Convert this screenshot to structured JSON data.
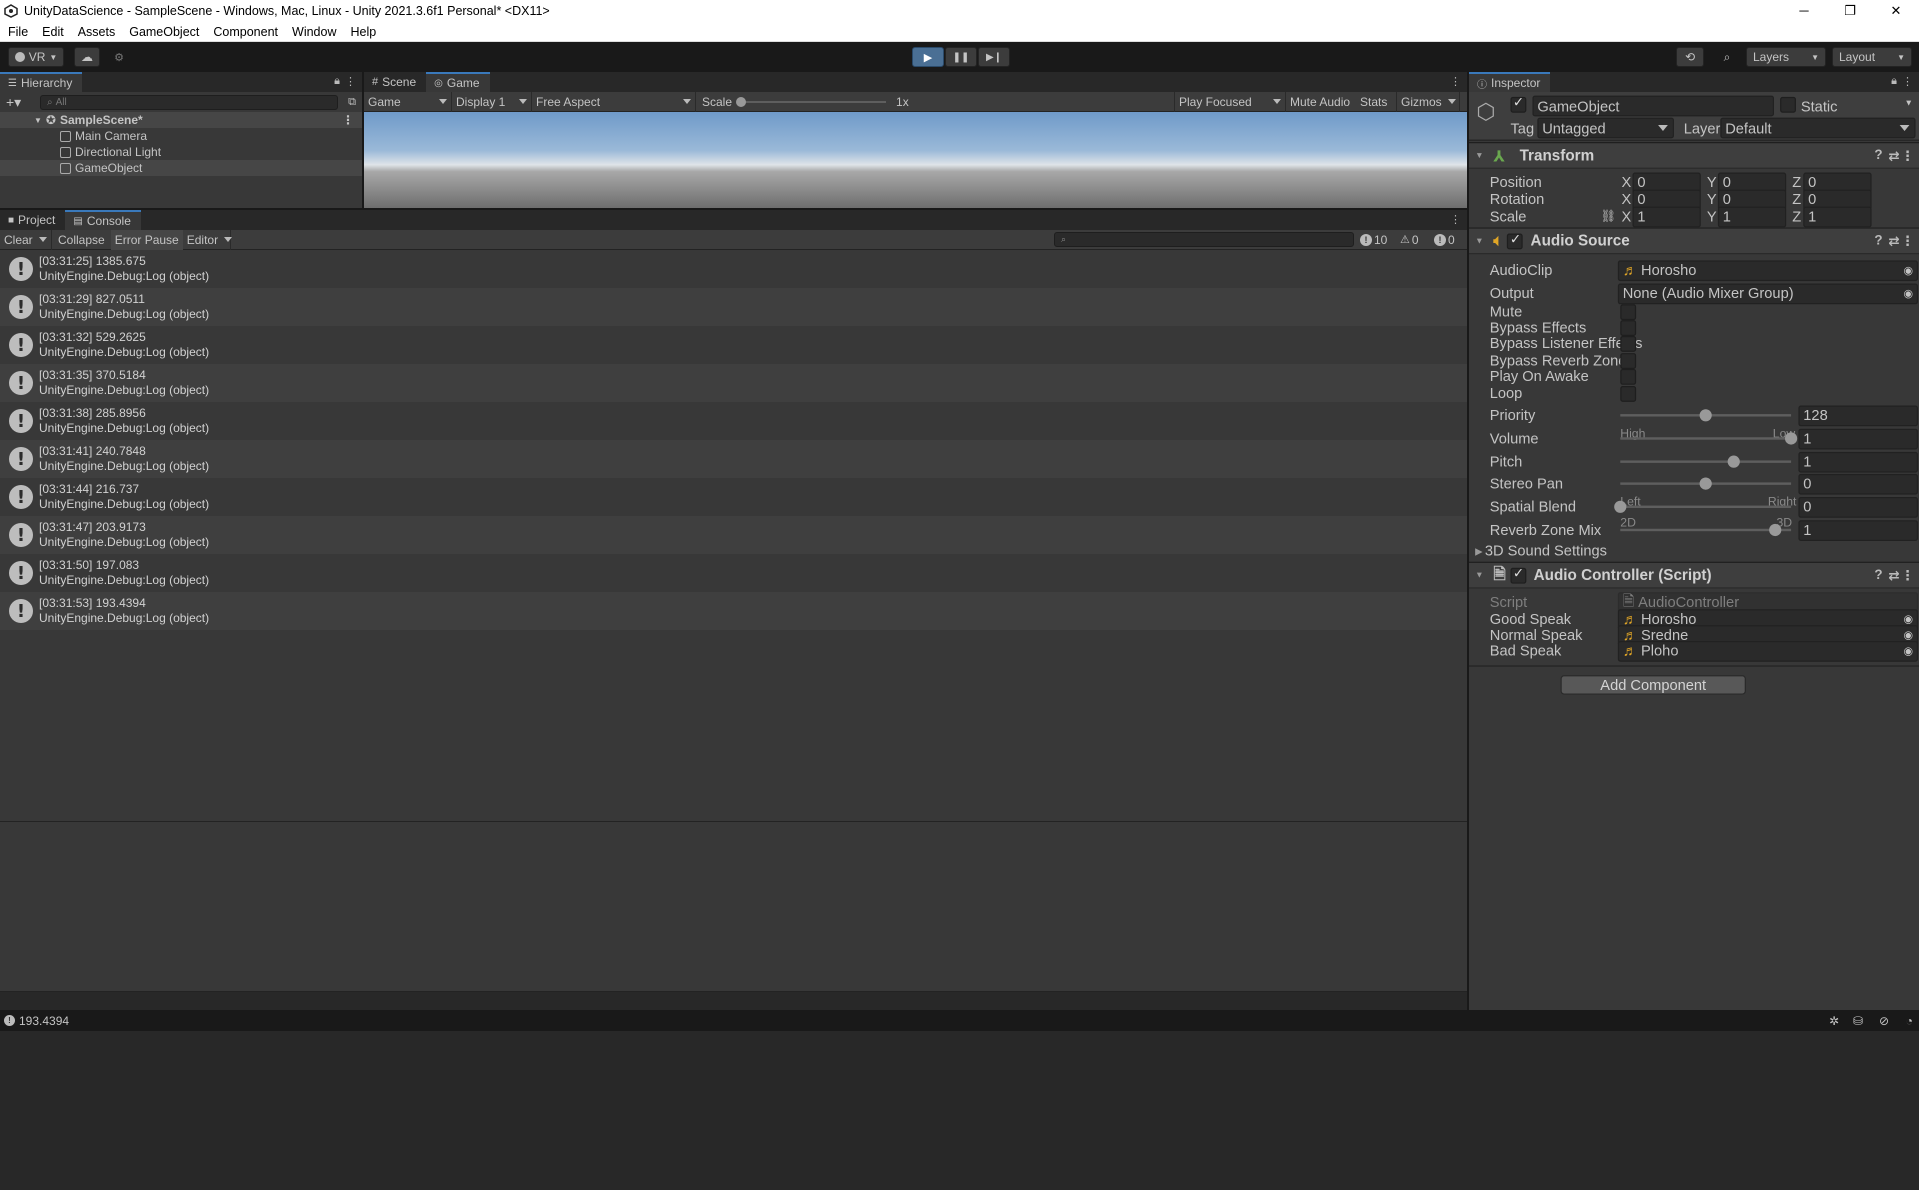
{
  "window": {
    "title": "UnityDataScience - SampleScene - Windows, Mac, Linux - Unity 2021.3.6f1 Personal* <DX11>",
    "minimize": "─",
    "maximize": "❐",
    "close": "✕"
  },
  "menu": [
    "File",
    "Edit",
    "Assets",
    "GameObject",
    "Component",
    "Window",
    "Help"
  ],
  "toolbar": {
    "account": "VR",
    "layers": "Layers",
    "layout": "Layout"
  },
  "hierarchy": {
    "tab": "Hierarchy",
    "search_placeholder": "All",
    "scene": "SampleScene*",
    "items": [
      "Main Camera",
      "Directional Light",
      "GameObject"
    ]
  },
  "game_view": {
    "tabs": [
      "Scene",
      "Game"
    ],
    "mode": "Game",
    "display": "Display 1",
    "aspect": "Free Aspect",
    "scale_label": "Scale",
    "scale_value": "1x",
    "play_focused": "Play Focused",
    "mute_audio": "Mute Audio",
    "stats": "Stats",
    "gizmos": "Gizmos"
  },
  "console": {
    "tabs": [
      "Project",
      "Console"
    ],
    "clear": "Clear",
    "collapse": "Collapse",
    "error_pause": "Error Pause",
    "editor": "Editor",
    "count_log": "10",
    "count_warn": "0",
    "count_error": "0",
    "entries": [
      {
        "line1": "[03:31:25] 1385.675",
        "line2": "UnityEngine.Debug:Log (object)"
      },
      {
        "line1": "[03:31:29] 827.0511",
        "line2": "UnityEngine.Debug:Log (object)"
      },
      {
        "line1": "[03:31:32] 529.2625",
        "line2": "UnityEngine.Debug:Log (object)"
      },
      {
        "line1": "[03:31:35] 370.5184",
        "line2": "UnityEngine.Debug:Log (object)"
      },
      {
        "line1": "[03:31:38] 285.8956",
        "line2": "UnityEngine.Debug:Log (object)"
      },
      {
        "line1": "[03:31:41] 240.7848",
        "line2": "UnityEngine.Debug:Log (object)"
      },
      {
        "line1": "[03:31:44] 216.737",
        "line2": "UnityEngine.Debug:Log (object)"
      },
      {
        "line1": "[03:31:47] 203.9173",
        "line2": "UnityEngine.Debug:Log (object)"
      },
      {
        "line1": "[03:31:50] 197.083",
        "line2": "UnityEngine.Debug:Log (object)"
      },
      {
        "line1": "[03:31:53] 193.4394",
        "line2": "UnityEngine.Debug:Log (object)"
      }
    ]
  },
  "inspector": {
    "tab": "Inspector",
    "object_name": "GameObject",
    "static": "Static",
    "tag_label": "Tag",
    "tag_value": "Untagged",
    "layer_label": "Layer",
    "layer_value": "Default",
    "transform": {
      "title": "Transform",
      "position": {
        "label": "Position",
        "x": "0",
        "y": "0",
        "z": "0"
      },
      "rotation": {
        "label": "Rotation",
        "x": "0",
        "y": "0",
        "z": "0"
      },
      "scale": {
        "label": "Scale",
        "x": "1",
        "y": "1",
        "z": "1"
      }
    },
    "audio_source": {
      "title": "Audio Source",
      "audioclip_label": "AudioClip",
      "audioclip_value": "Horosho",
      "output_label": "Output",
      "output_value": "None (Audio Mixer Group)",
      "toggles": [
        "Mute",
        "Bypass Effects",
        "Bypass Listener Effects",
        "Bypass Reverb Zones",
        "Play On Awake",
        "Loop"
      ],
      "priority": {
        "label": "Priority",
        "value": "128",
        "min_label": "High",
        "max_label": "Low",
        "fraction": 0.5
      },
      "volume": {
        "label": "Volume",
        "value": "1",
        "fraction": 1.0
      },
      "pitch": {
        "label": "Pitch",
        "value": "1",
        "fraction": 0.667
      },
      "stereo_pan": {
        "label": "Stereo Pan",
        "value": "0",
        "min_label": "Left",
        "max_label": "Right",
        "fraction": 0.5
      },
      "spatial_blend": {
        "label": "Spatial Blend",
        "value": "0",
        "min_label": "2D",
        "max_label": "3D",
        "fraction": 0.0
      },
      "reverb_zone_mix": {
        "label": "Reverb Zone Mix",
        "value": "1",
        "fraction": 0.909
      },
      "sound_settings": "3D Sound Settings"
    },
    "audio_controller": {
      "title": "Audio Controller (Script)",
      "script_label": "Script",
      "script_value": "AudioController",
      "good_label": "Good Speak",
      "good_value": "Horosho",
      "normal_label": "Normal Speak",
      "normal_value": "Sredne",
      "bad_label": "Bad Speak",
      "bad_value": "Ploho"
    },
    "add_component": "Add Component"
  },
  "statusbar": {
    "text": "193.4394"
  }
}
